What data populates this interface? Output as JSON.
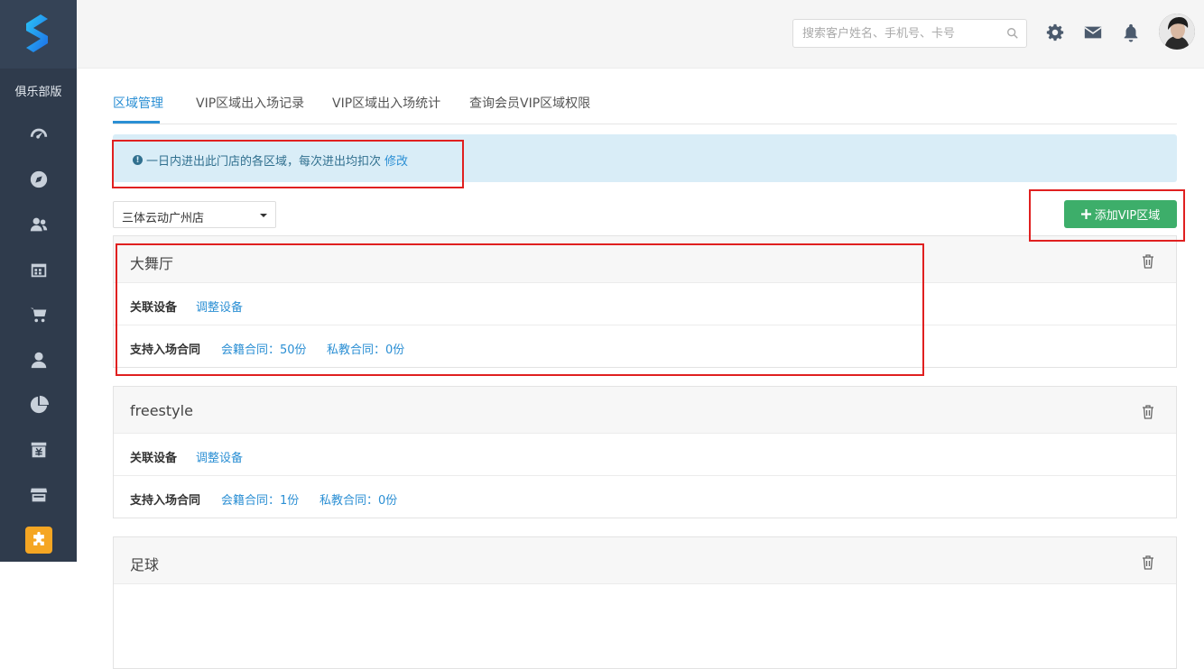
{
  "sidebar": {
    "club_label": "俱乐部版",
    "items": [
      {
        "icon": "dashboard-icon"
      },
      {
        "icon": "compass-icon"
      },
      {
        "icon": "members-icon"
      },
      {
        "icon": "calendar-icon"
      },
      {
        "icon": "cart-icon"
      },
      {
        "icon": "coach-icon"
      },
      {
        "icon": "pie-chart-icon"
      },
      {
        "icon": "finance-icon"
      },
      {
        "icon": "store-icon"
      },
      {
        "icon": "puzzle-icon"
      }
    ]
  },
  "header": {
    "search_placeholder": "搜索客户姓名、手机号、卡号"
  },
  "tabs": [
    {
      "label": "区域管理",
      "active": true
    },
    {
      "label": "VIP区域出入场记录",
      "active": false
    },
    {
      "label": "VIP区域出入场统计",
      "active": false
    },
    {
      "label": "查询会员VIP区域权限",
      "active": false
    }
  ],
  "notice": {
    "text": "一日内进出此门店的各区域，每次进出均扣次",
    "link": "修改"
  },
  "store_select": {
    "value": "三体云动广州店"
  },
  "add_button": {
    "label": "添加VIP区域"
  },
  "zones": [
    {
      "name": "大舞厅",
      "device_label": "关联设备",
      "device_link": "调整设备",
      "contract_label": "支持入场合同",
      "membership": "会籍合同：50份",
      "private": "私教合同：0份"
    },
    {
      "name": "freestyle",
      "device_label": "关联设备",
      "device_link": "调整设备",
      "contract_label": "支持入场合同",
      "membership": "会籍合同：1份",
      "private": "私教合同：0份"
    },
    {
      "name": "足球"
    }
  ],
  "colors": {
    "accent": "#2b8fd4",
    "add_button": "#3dae6a",
    "sidebar": "#2f3b4c",
    "highlight_box": "#e02020",
    "active_nav": "#f5a623"
  }
}
